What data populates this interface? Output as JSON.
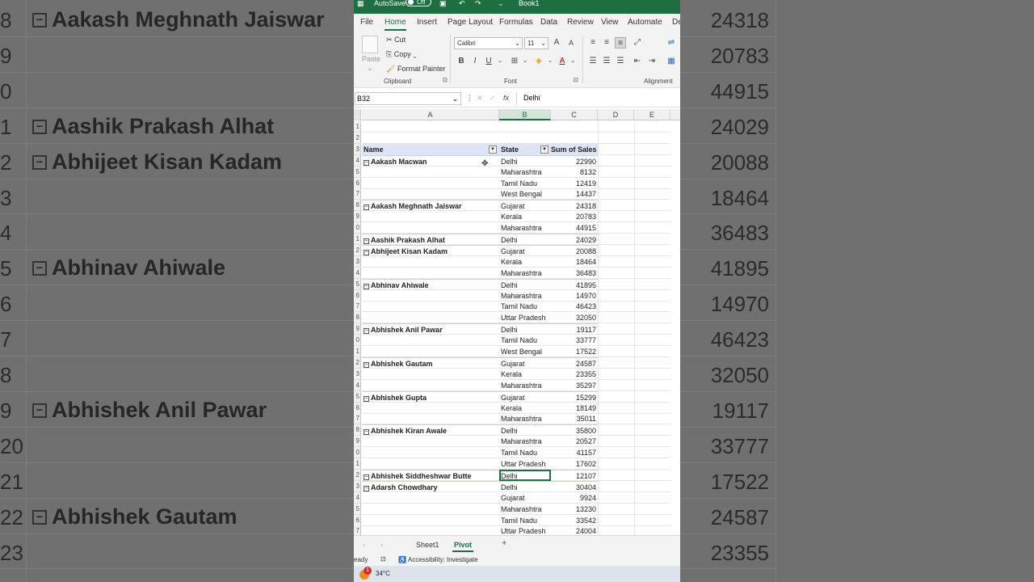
{
  "app": {
    "autosave_label": "AutoSave",
    "autosave_state": "Off",
    "book_title": "Book1",
    "accent": "#1d6f42"
  },
  "tabs": [
    "File",
    "Home",
    "Insert",
    "Page Layout",
    "Formulas",
    "Data",
    "Review",
    "View",
    "Automate",
    "De"
  ],
  "active_tab": "Home",
  "ribbon": {
    "paste_label": "Paste",
    "cut_label": "Cut",
    "copy_label": "Copy",
    "format_painter_label": "Format Painter",
    "clipboard_label": "Clipboard",
    "font_name": "Calibri",
    "font_size": "11",
    "font_label": "Font",
    "alignment_label": "Alignment",
    "bold": "B",
    "italic": "I",
    "underline": "U",
    "grow": "A",
    "shrink": "A",
    "font_color": "A"
  },
  "formula_bar": {
    "name_box": "B32",
    "fx": "fx",
    "content": "Delhi"
  },
  "columns": [
    "A",
    "B",
    "C",
    "D",
    "E"
  ],
  "pivot_headers": {
    "name": "Name",
    "state": "State",
    "sales": "Sum of Sales"
  },
  "row_numbers_top": [
    "1",
    "2",
    "3"
  ],
  "rows": [
    {
      "rn": "4",
      "name": "Aakash Macwan",
      "state": "Delhi",
      "sales": "22990"
    },
    {
      "rn": "5",
      "name": "",
      "state": "Maharashtra",
      "sales": "8132"
    },
    {
      "rn": "6",
      "name": "",
      "state": "Tamil Nadu",
      "sales": "12419"
    },
    {
      "rn": "7",
      "name": "",
      "state": "West Bengal",
      "sales": "14437"
    },
    {
      "rn": "8",
      "name": "Aakash Meghnath Jaiswar",
      "state": "Gujarat",
      "sales": "24318"
    },
    {
      "rn": "9",
      "name": "",
      "state": "Kerala",
      "sales": "20783"
    },
    {
      "rn": "0",
      "name": "",
      "state": "Maharashtra",
      "sales": "44915"
    },
    {
      "rn": "1",
      "name": "Aashik Prakash Alhat",
      "state": "Delhi",
      "sales": "24029"
    },
    {
      "rn": "2",
      "name": "Abhijeet Kisan Kadam",
      "state": "Gujarat",
      "sales": "20088"
    },
    {
      "rn": "3",
      "name": "",
      "state": "Kerala",
      "sales": "18464"
    },
    {
      "rn": "4",
      "name": "",
      "state": "Maharashtra",
      "sales": "36483"
    },
    {
      "rn": "5",
      "name": "Abhinav Ahiwale",
      "state": "Delhi",
      "sales": "41895"
    },
    {
      "rn": "6",
      "name": "",
      "state": "Maharashtra",
      "sales": "14970"
    },
    {
      "rn": "7",
      "name": "",
      "state": "Tamil Nadu",
      "sales": "46423"
    },
    {
      "rn": "8",
      "name": "",
      "state": "Uttar Pradesh",
      "sales": "32050"
    },
    {
      "rn": "9",
      "name": "Abhishek Anil Pawar",
      "state": "Delhi",
      "sales": "19117"
    },
    {
      "rn": "0",
      "name": "",
      "state": "Tamil Nadu",
      "sales": "33777"
    },
    {
      "rn": "1",
      "name": "",
      "state": "West Bengal",
      "sales": "17522"
    },
    {
      "rn": "2",
      "name": "Abhishek Gautam",
      "state": "Gujarat",
      "sales": "24587"
    },
    {
      "rn": "3",
      "name": "",
      "state": "Kerala",
      "sales": "23355"
    },
    {
      "rn": "4",
      "name": "",
      "state": "Maharashtra",
      "sales": "35297"
    },
    {
      "rn": "5",
      "name": "Abhishek Gupta",
      "state": "Gujarat",
      "sales": "15299"
    },
    {
      "rn": "6",
      "name": "",
      "state": "Kerala",
      "sales": "18149"
    },
    {
      "rn": "7",
      "name": "",
      "state": "Maharashtra",
      "sales": "35011"
    },
    {
      "rn": "8",
      "name": "Abhishek Kiran Awale",
      "state": "Delhi",
      "sales": "35800"
    },
    {
      "rn": "9",
      "name": "",
      "state": "Maharashtra",
      "sales": "20527"
    },
    {
      "rn": "0",
      "name": "",
      "state": "Tamil Nadu",
      "sales": "41157"
    },
    {
      "rn": "1",
      "name": "",
      "state": "Uttar Pradesh",
      "sales": "17602"
    },
    {
      "rn": "2",
      "name": "Abhishek Siddheshwar Butte",
      "state": "Delhi",
      "sales": "12107",
      "selected": true
    },
    {
      "rn": "3",
      "name": "Adarsh Chowdhary",
      "state": "Delhi",
      "sales": "30404"
    },
    {
      "rn": "4",
      "name": "",
      "state": "Gujarat",
      "sales": "9924"
    },
    {
      "rn": "5",
      "name": "",
      "state": "Maharashtra",
      "sales": "13230"
    },
    {
      "rn": "6",
      "name": "",
      "state": "Tamil Nadu",
      "sales": "33542"
    },
    {
      "rn": "7",
      "name": "",
      "state": "Uttar Pradesh",
      "sales": "24004"
    }
  ],
  "sheets": [
    "Sheet1",
    "Pivot"
  ],
  "active_sheet": "Pivot",
  "add_sheet": "+",
  "status": {
    "ready": "eady",
    "accessibility": "Accessibility: Investigate"
  },
  "taskbar": {
    "weather": "34°C",
    "badge": "1"
  },
  "background_left": {
    "rows": [
      {
        "num": "8",
        "name": "Aakash Meghnath Jaiswar"
      },
      {
        "num": "9",
        "name": ""
      },
      {
        "num": "0",
        "name": ""
      },
      {
        "num": "1",
        "name": "Aashik Prakash Alhat"
      },
      {
        "num": "2",
        "name": "Abhijeet Kisan Kadam"
      },
      {
        "num": "3",
        "name": ""
      },
      {
        "num": "4",
        "name": ""
      },
      {
        "num": "5",
        "name": "Abhinav Ahiwale"
      },
      {
        "num": "6",
        "name": ""
      },
      {
        "num": "7",
        "name": ""
      },
      {
        "num": "8",
        "name": ""
      },
      {
        "num": "9",
        "name": "Abhishek Anil Pawar"
      },
      {
        "num": "20",
        "name": ""
      },
      {
        "num": "21",
        "name": ""
      },
      {
        "num": "22",
        "name": "Abhishek Gautam"
      },
      {
        "num": "23",
        "name": ""
      }
    ]
  },
  "background_right": {
    "values": [
      "24318",
      "20783",
      "44915",
      "24029",
      "20088",
      "18464",
      "36483",
      "41895",
      "14970",
      "46423",
      "32050",
      "19117",
      "33777",
      "17522",
      "24587",
      "23355"
    ]
  }
}
